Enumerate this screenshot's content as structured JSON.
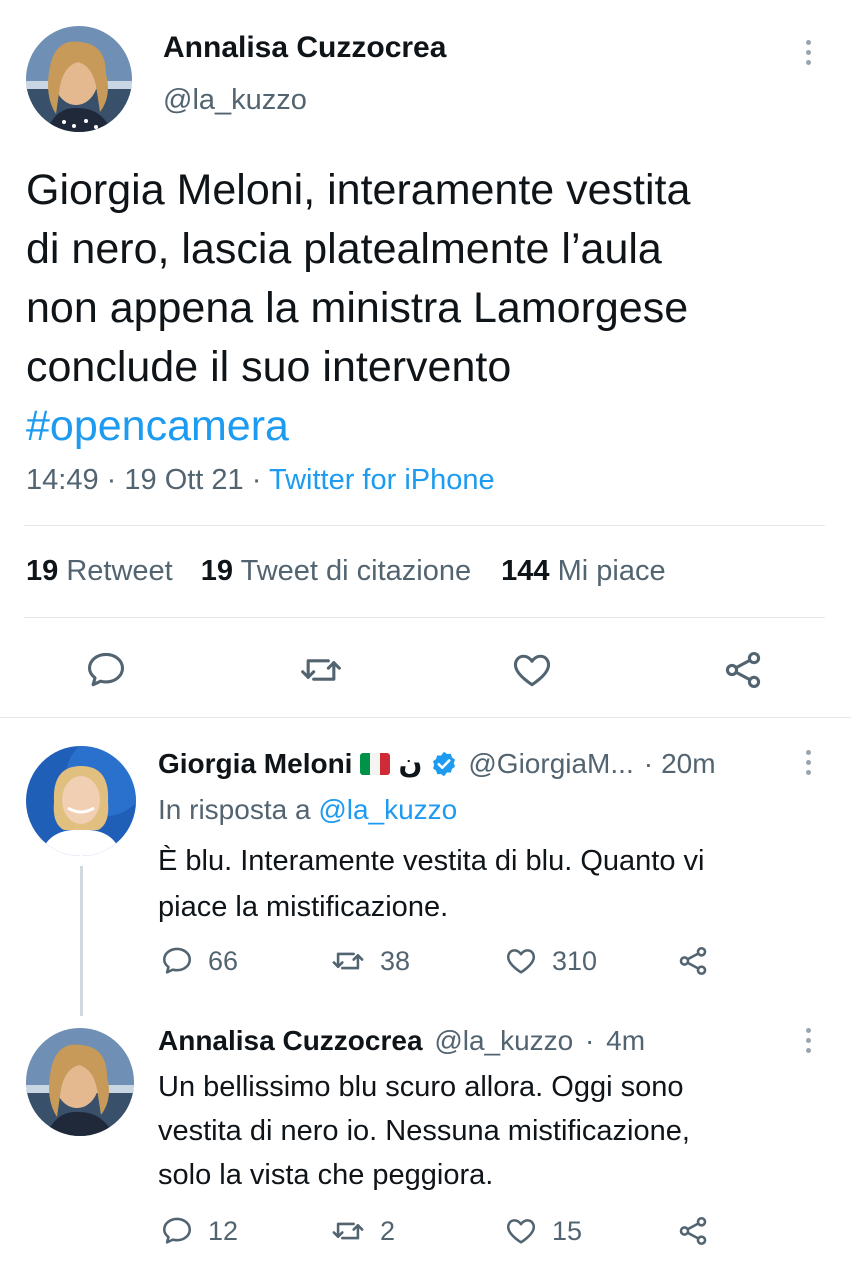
{
  "main_tweet": {
    "author_name": "Annalisa Cuzzocrea",
    "handle": "@la_kuzzo",
    "text_lines": [
      "Giorgia Meloni, interamente vestita",
      "di nero, lascia platealmente l’aula",
      "non appena la ministra Lamorgese",
      "conclude il suo intervento"
    ],
    "hashtag": "#opencamera",
    "time": "14:49",
    "date": "19 Ott 21",
    "source": "Twitter for iPhone",
    "separator": "·",
    "stats": {
      "retweets_count": "19",
      "retweets_label": "Retweet",
      "quotes_count": "19",
      "quotes_label": "Tweet di citazione",
      "likes_count": "144",
      "likes_label": "Mi piace"
    },
    "actions": [
      "reply-icon",
      "retweet-icon",
      "like-icon",
      "share-icon"
    ]
  },
  "replies": [
    {
      "author_name": "Giorgia Meloni",
      "extra_glyph": "ن",
      "flag": "italian-flag",
      "verified": true,
      "handle": "@GiorgiaM...",
      "time": "20m",
      "reply_to_prefix": "In risposta a",
      "reply_to_handle": "@la_kuzzo",
      "text_lines": [
        "È blu. Interamente vestita di blu. Quanto vi",
        "piace la mistificazione."
      ],
      "reply_count": "66",
      "retweet_count": "38",
      "like_count": "310"
    },
    {
      "author_name": "Annalisa Cuzzocrea",
      "handle": "@la_kuzzo",
      "time": "4m",
      "text_lines": [
        "Un bellissimo blu scuro allora. Oggi sono",
        "vestita di nero io. Nessuna mistificazione,",
        "solo la vista che peggiora."
      ],
      "reply_count": "12",
      "retweet_count": "2",
      "like_count": "15"
    }
  ],
  "colors": {
    "text": "#0f1419",
    "muted": "#536471",
    "link": "#1d9bf0",
    "divider": "#e6e9eb",
    "thread_line": "#cfd9de"
  }
}
